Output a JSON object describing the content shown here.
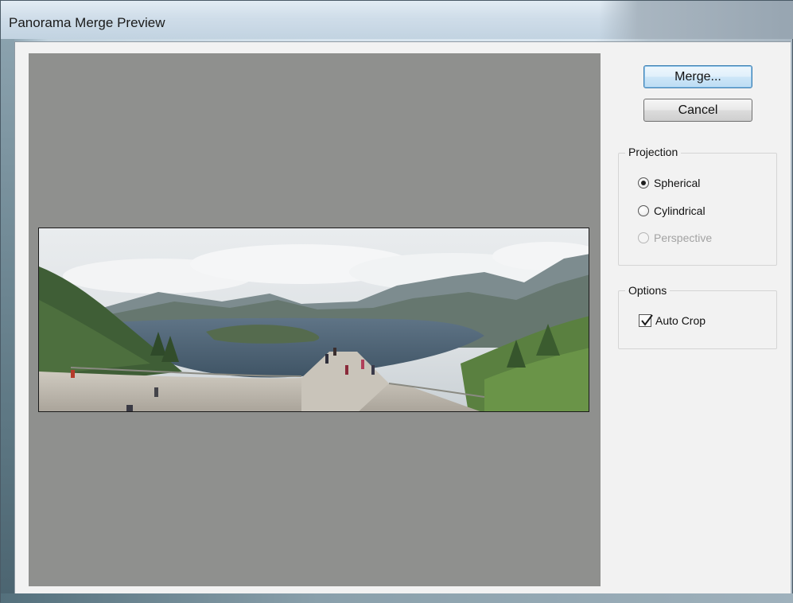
{
  "window": {
    "title": "Panorama Merge Preview"
  },
  "buttons": {
    "merge_label": "Merge...",
    "cancel_label": "Cancel"
  },
  "projection": {
    "legend": "Projection",
    "options": [
      {
        "label": "Spherical",
        "selected": true,
        "enabled": true
      },
      {
        "label": "Cylindrical",
        "selected": false,
        "enabled": true
      },
      {
        "label": "Perspective",
        "selected": false,
        "enabled": false
      }
    ]
  },
  "options": {
    "legend": "Options",
    "auto_crop_label": "Auto Crop",
    "auto_crop_checked": true
  },
  "colors": {
    "preview_background": "#8f908e",
    "dialog_background": "#f2f2f2",
    "default_button_border": "#3c7fb1"
  }
}
